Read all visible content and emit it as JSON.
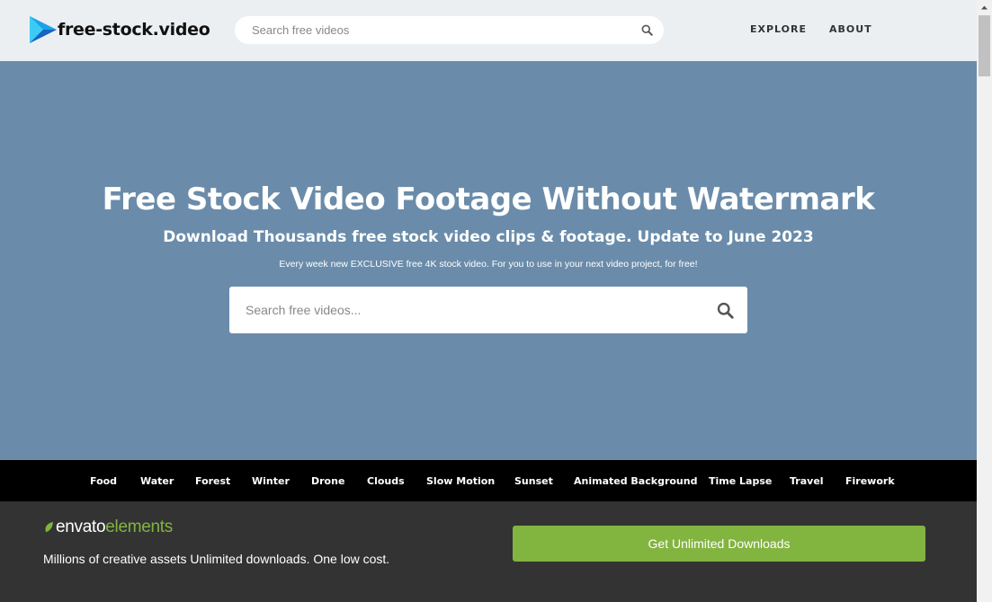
{
  "header": {
    "logo_text": "free-stock.video",
    "search_placeholder": "Search free videos",
    "nav": {
      "explore": "EXPLORE",
      "about": "ABOUT"
    }
  },
  "hero": {
    "title": "Free Stock Video Footage Without Watermark",
    "subtitle": "Download Thousands free stock video clips & footage. Update to June 2023",
    "tagline": "Every week new EXCLUSIVE free 4K stock video. For you to use in your next video project, for free!",
    "search_placeholder": "Search free videos..."
  },
  "categories": [
    "Food",
    "Water",
    "Forest",
    "Winter",
    "Drone",
    "Clouds",
    "Slow Motion",
    "Sunset",
    "Animated Background",
    "Time Lapse",
    "Travel",
    "Firework"
  ],
  "promo": {
    "brand_name": "envato",
    "brand_suffix": "elements",
    "text": "Millions of creative assets Unlimited downloads. One low cost.",
    "button_label": "Get Unlimited Downloads"
  },
  "colors": {
    "hero_bg": "#6a8caa",
    "header_bg": "#ebeff2",
    "promo_bg": "#333333",
    "accent_green": "#82b440",
    "category_bar_bg": "#000000"
  }
}
